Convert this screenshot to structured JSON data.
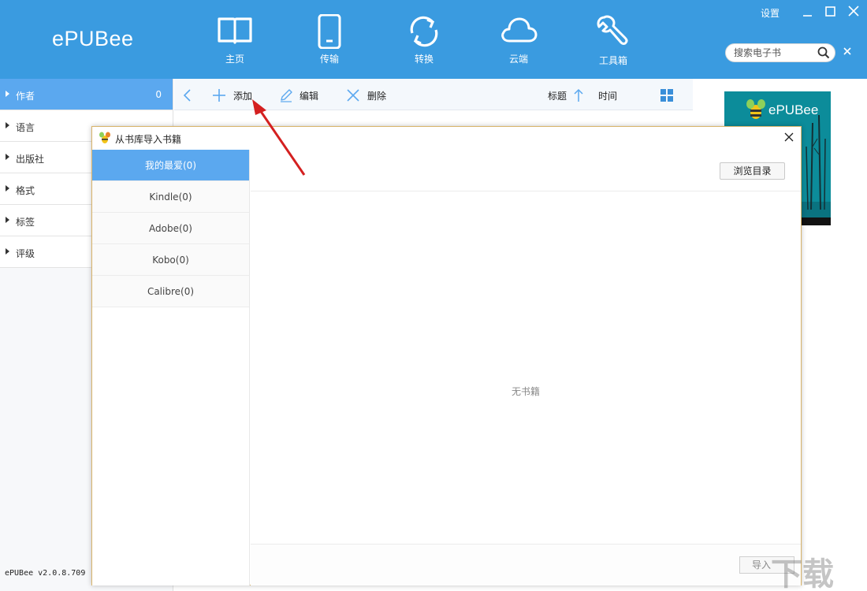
{
  "app": {
    "logo": "ePUBee",
    "settings_label": "设置",
    "version": "ePUBee v2.0.8.709"
  },
  "nav": {
    "home": "主页",
    "transfer": "传输",
    "convert": "转换",
    "cloud": "云端",
    "tools": "工具箱"
  },
  "search": {
    "placeholder": "搜索电子书",
    "value": ""
  },
  "sidebar": {
    "items": [
      {
        "label": "作者",
        "count": "0",
        "active": true
      },
      {
        "label": "语言",
        "count": "",
        "active": false
      },
      {
        "label": "出版社",
        "count": "",
        "active": false
      },
      {
        "label": "格式",
        "count": "",
        "active": false
      },
      {
        "label": "标签",
        "count": "",
        "active": false
      },
      {
        "label": "评级",
        "count": "",
        "active": false
      }
    ]
  },
  "toolbar": {
    "add": "添加",
    "edit": "编辑",
    "delete": "删除",
    "sort_title": "标题",
    "sort_time": "时间"
  },
  "ad": {
    "title": "ePUBee"
  },
  "dialog": {
    "title": "从书库导入书籍",
    "sources": [
      {
        "label": "我的最爱(0)",
        "active": true
      },
      {
        "label": "Kindle(0)",
        "active": false
      },
      {
        "label": "Adobe(0)",
        "active": false
      },
      {
        "label": "Kobo(0)",
        "active": false
      },
      {
        "label": "Calibre(0)",
        "active": false
      }
    ],
    "browse_label": "浏览目录",
    "empty_text": "无书籍",
    "import_label": "导入"
  },
  "colors": {
    "header": "#3a9be0",
    "active_item": "#5ba8ef",
    "annotation_arrow": "#d42020"
  },
  "icons": {
    "nav": [
      "book-icon",
      "phone-icon",
      "sync-icon",
      "cloud-icon",
      "wrench-icon"
    ],
    "toolbar": [
      "back-chevron-icon",
      "plus-icon",
      "pencil-icon",
      "x-icon",
      "arrow-up-icon",
      "grid-view-icon"
    ]
  }
}
